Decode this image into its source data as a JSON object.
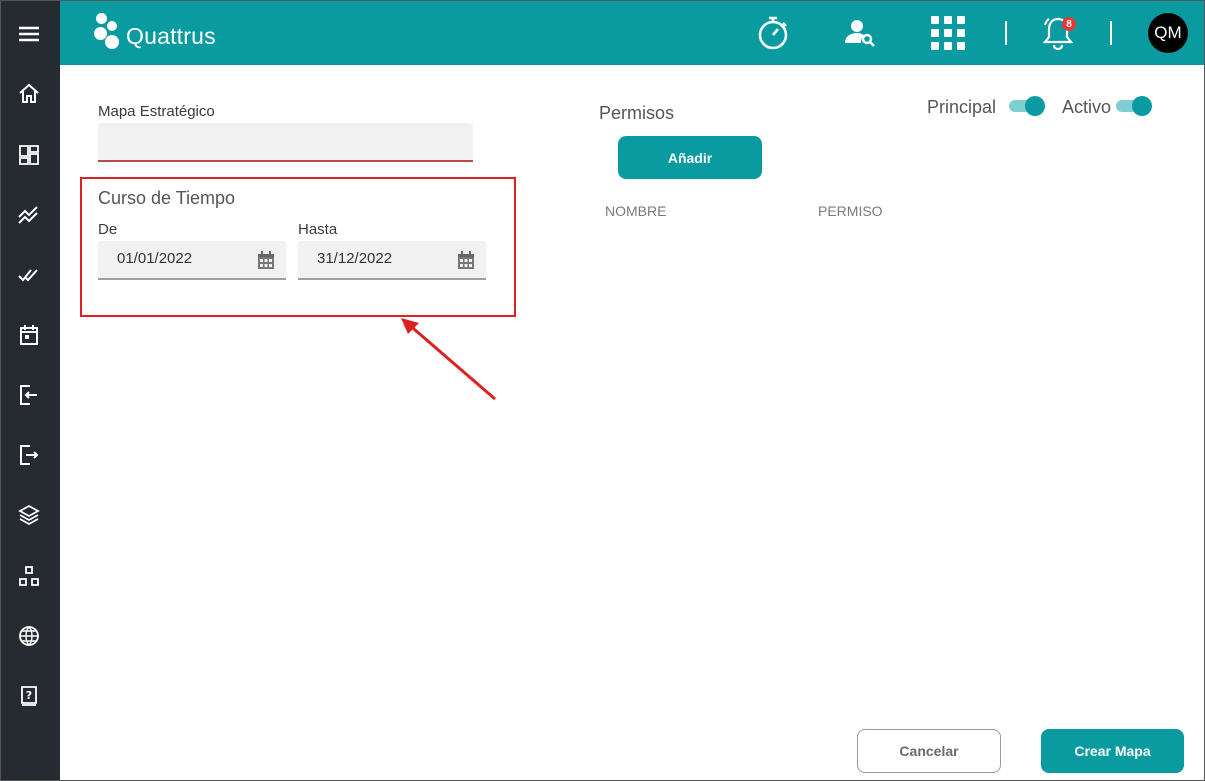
{
  "app": {
    "logo_text": "Quattrus",
    "avatar_initials": "QM",
    "notification_count": "8",
    "accent_color": "#0a9ba0"
  },
  "sidebar": {
    "items": [
      {
        "name": "menu-icon"
      },
      {
        "name": "home-icon"
      },
      {
        "name": "dashboard-icon"
      },
      {
        "name": "trend-icon"
      },
      {
        "name": "double-check-icon"
      },
      {
        "name": "calendar-icon"
      },
      {
        "name": "login-icon"
      },
      {
        "name": "logout-icon"
      },
      {
        "name": "layers-icon"
      },
      {
        "name": "hierarchy-icon"
      },
      {
        "name": "globe-icon"
      },
      {
        "name": "help-book-icon"
      }
    ]
  },
  "topbar": {
    "icons": [
      "stopwatch-icon",
      "user-search-icon",
      "apps-grid-icon",
      "bell-icon"
    ]
  },
  "form": {
    "mapa_label": "Mapa Estratégico",
    "mapa_value": "",
    "curso_title": "Curso de Tiempo",
    "de_label": "De",
    "de_value": "01/01/2022",
    "hasta_label": "Hasta",
    "hasta_value": "31/12/2022"
  },
  "permisos": {
    "title": "Permisos",
    "add_label": "Añadir",
    "columns": [
      "NOMBRE",
      "PERMISO"
    ]
  },
  "toggles": [
    {
      "label": "Principal",
      "on": true
    },
    {
      "label": "Activo",
      "on": true
    }
  ],
  "actions": {
    "cancel_label": "Cancelar",
    "create_label": "Crear Mapa"
  }
}
